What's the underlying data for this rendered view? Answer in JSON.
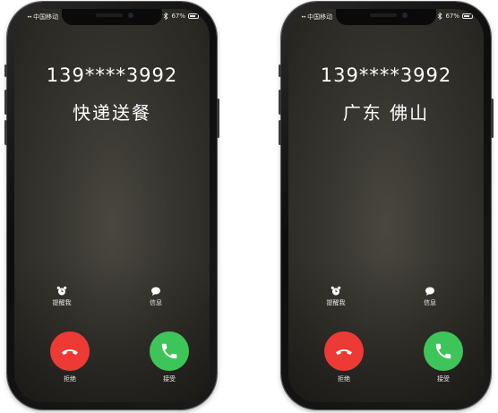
{
  "status_bar": {
    "signal": "••",
    "carrier": "中国移动",
    "battery": "67%"
  },
  "screens": [
    {
      "phone_number": "139****3992",
      "caller_label": "快递送餐",
      "remind_label": "提醒我",
      "message_label": "信息",
      "decline_label": "拒绝",
      "accept_label": "接受"
    },
    {
      "phone_number": "139****3992",
      "caller_label": "广东 佛山",
      "remind_label": "提醒我",
      "message_label": "信息",
      "decline_label": "拒绝",
      "accept_label": "接受"
    }
  ],
  "colors": {
    "decline": "#ee3a35",
    "accept": "#3ec55a",
    "text": "#ffffff"
  },
  "icons": {
    "remind": "alarm-clock-icon",
    "message": "speech-bubble-icon",
    "decline": "phone-hangup-icon",
    "accept": "phone-icon"
  }
}
